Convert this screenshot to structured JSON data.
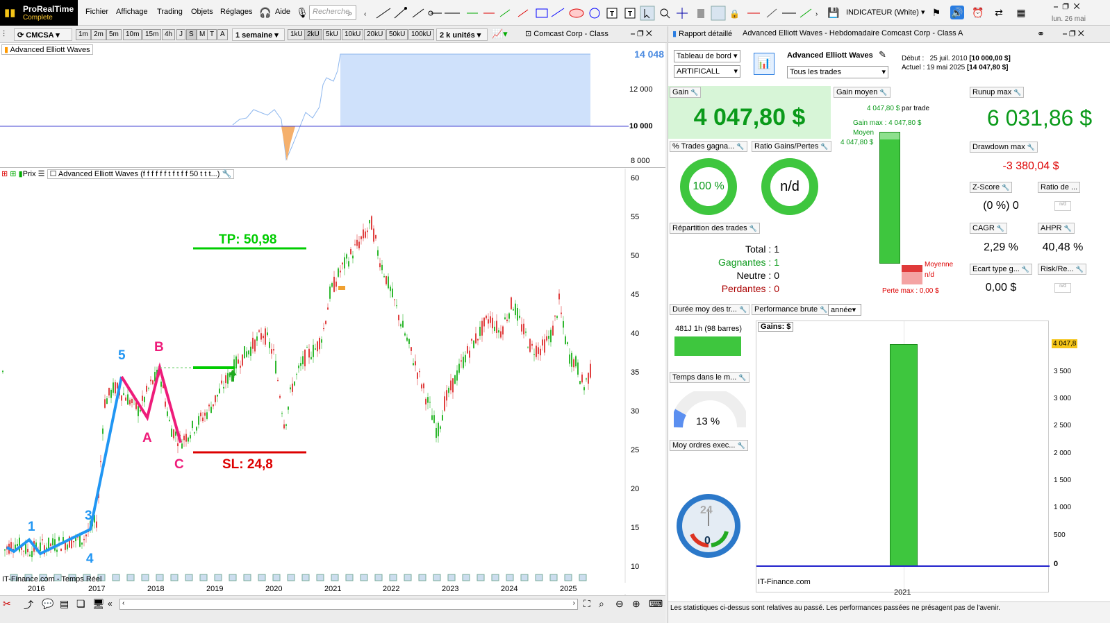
{
  "app": {
    "name": "ProRealTime",
    "edition": "Complete",
    "date": "lun. 26 mai"
  },
  "menu": [
    "Fichier",
    "Affichage",
    "Trading",
    "Objets",
    "Réglages",
    "Aide"
  ],
  "search": {
    "placeholder": "Recherche"
  },
  "indicator_dd": "INDICATEUR (White)",
  "chart": {
    "symbol": "CMCSA",
    "timeframes": [
      "1m",
      "2m",
      "5m",
      "10m",
      "15m",
      "4h",
      "J",
      "S",
      "M",
      "T",
      "A"
    ],
    "period": "1 semaine",
    "units": [
      "1kU",
      "2kU",
      "5kU",
      "10kU",
      "20kU",
      "50kU",
      "100kU"
    ],
    "unit_count": "2 k unités",
    "title": "Comcast Corp - Class",
    "eq_panel_label": "Advanced Elliott Waves",
    "eq_last": "14 048",
    "eq_ticks": [
      "12 000",
      "10 000",
      "8 000"
    ],
    "price_label": "Prix",
    "indicator_label": "Advanced Elliott Waves (f f f f f f t f t f f 50 t t t...)",
    "price_ticks": [
      "60",
      "55",
      "50",
      "45",
      "40",
      "35",
      "30",
      "25",
      "20",
      "15",
      "10"
    ],
    "years": [
      "2016",
      "2017",
      "2018",
      "2019",
      "2020",
      "2021",
      "2022",
      "2023",
      "2024",
      "2025"
    ],
    "tp": "TP: 50,98",
    "sl": "SL: 24,8",
    "wave_labels": {
      "w1": "1",
      "w3": "3",
      "w4": "4",
      "w5": "5",
      "wA": "A",
      "wB": "B",
      "wC": "C"
    },
    "source": "IT-Finance.com - Temps Réel"
  },
  "report": {
    "tabs": [
      "Rapport détaillé",
      "Advanced Elliott Waves - Hebdomadaire",
      "Comcast Corp - Class A"
    ],
    "dashboard": "Tableau de bord",
    "account": "ARTIFICALL",
    "strategy": "Advanced Elliott Waves",
    "trades_filter": "Tous les trades",
    "start_lbl": "Début :",
    "start": "25 juil. 2010",
    "start_val": "[10 000,00 $]",
    "now_lbl": "Actuel :",
    "now": "19 mai 2025",
    "now_val": "[14 047,80 $]",
    "gain_h": "Gain",
    "gain": "4 047,80 $",
    "avg_gain_h": "Gain moyen",
    "avg_per_trade": "4 047,80 $",
    "per_trade": "par trade",
    "gain_max": "Gain max : 4 047,80 $",
    "moyen": "Moyen",
    "moyen_val": "4 047,80 $",
    "moyenne": "Moyenne",
    "nd": "n/d",
    "perte_max": "Perte max : 0,00 $",
    "runup_h": "Runup max",
    "runup": "6 031,86 $",
    "dd_h": "Drawdown max",
    "dd": "-3 380,04 $",
    "zscore_h": "Z-Score",
    "zscore": "(0 %) 0",
    "ratio_h": "Ratio de ...",
    "cagr_h": "CAGR",
    "cagr": "2,29 %",
    "ahpr_h": "AHPR",
    "ahpr": "40,48 %",
    "std_h": "Ecart type g...",
    "std": "0,00 $",
    "riskre_h": "Risk/Re...",
    "win_h": "% Trades gagna...",
    "win_pct": "100 %",
    "ratio_gp_h": "Ratio Gains/Pertes",
    "ratio_gp": "n/d",
    "repart_h": "Répartition des trades",
    "total_l": "Total :",
    "total": "1",
    "gagnantes_l": "Gagnantes :",
    "gagnantes": "1",
    "neutre_l": "Neutre :",
    "neutre": "0",
    "perdantes_l": "Perdantes :",
    "perdantes": "0",
    "duree_h": "Durée moy des tr...",
    "duree": "481J 1h (98 barres)",
    "temps_h": "Temps dans le m...",
    "temps": "13 %",
    "moy_ordres_h": "Moy ordres exec...",
    "clock_num": "24",
    "clock_zero": "0",
    "perf_h": "Performance brute",
    "perf_period": "année",
    "gains_lbl": "Gains: $",
    "perf_value": "4 047,8",
    "perf_ticks": [
      "3 500",
      "3 000",
      "2 500",
      "2 000",
      "1 500",
      "1 000",
      "500",
      "0"
    ],
    "perf_year": "2021",
    "perf_source": "IT-Finance.com",
    "disclaimer": "Les statistiques ci-dessus sont relatives au passé. Les performances passées ne présagent pas de l'avenir."
  },
  "colors": {
    "green": "#00cc00",
    "red": "#dd0000",
    "blue": "#2196f3",
    "pink": "#ee1c7a",
    "bar": "#3ec63e"
  }
}
